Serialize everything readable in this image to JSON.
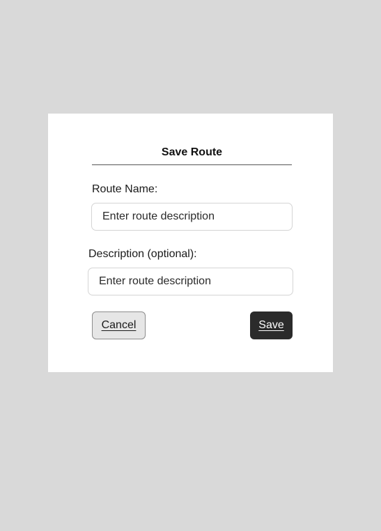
{
  "dialog": {
    "title": "Save Route",
    "route_name_label": "Route Name:",
    "route_name_placeholder": "Enter route description",
    "description_label": "Description (optional):",
    "description_placeholder": "Enter route description",
    "cancel_label": "Cancel",
    "save_label": "Save"
  },
  "colors": {
    "backdrop": "#d9d9d9",
    "dialog_background": "#ffffff",
    "save_button": "#2b2b2b",
    "cancel_button": "#e6e6e6"
  }
}
